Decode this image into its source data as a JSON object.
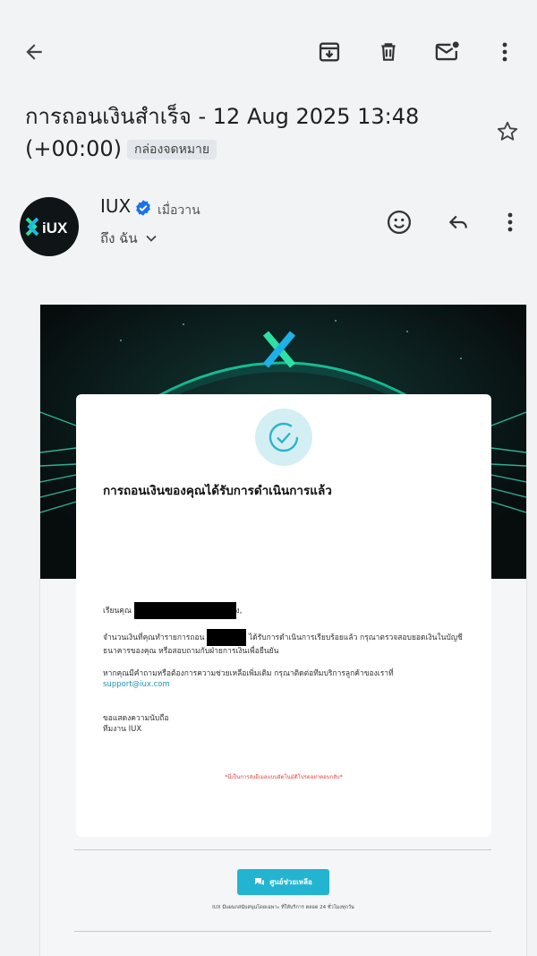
{
  "toolbar": {
    "back": "arrow-back-icon",
    "archive": "archive-icon",
    "delete": "trash-icon",
    "mark_unread": "mark-unread-icon",
    "more": "more-vert-icon"
  },
  "email": {
    "subject": "การถอนเงินสำเร็จ - 12 Aug 2025 13:48 (+00:00)",
    "label": "กล่องจดหมาย",
    "sender": "IUX",
    "time": "เมื่อวาน",
    "to": "ถึง ฉัน",
    "avatar_text": "iUX"
  },
  "body": {
    "title": "การถอนเงินของคุณได้รับการดำเนินการแล้ว",
    "greeting_prefix": "เรียนคุณ",
    "greeting_suffix": "ง,",
    "para1_prefix": "จำนวนเงินที่คุณทำรายการถอน",
    "para1_rest": "ได้รับการดำเนินการเรียบร้อยแล้ว กรุณาตรวจสอบยอดเงินในบัญชีธนาคารของคุณ หรือสอบถามกับฝ่ายการเงินเพื่อยืนยัน",
    "para2": "หากคุณมีคำถามหรือต้องการความช่วยเหลือเพิ่มเติม กรุณาติดต่อทีมบริการลูกค้าของเราที่",
    "support_email": "support@iux.com",
    "thanks": "ขอแสดงความนับถือ",
    "team": "ทีมงาน IUX",
    "auto_note": "*นี่เป็นการส่งอีเมลแบบอัตโนมัติโปรดอย่าตอบกลับ*",
    "help_button": "ศูนย์ช่วยเหลือ",
    "footer": "IUX มีแผนกสนับสนุนโดยเฉพาะ ที่ให้บริการ ตลอด 24 ชั่วโมงทุกวัน"
  },
  "colors": {
    "accent": "#23b4d2",
    "link": "#1d93b3",
    "verified": "#1a73e8",
    "note_red": "#e23b3b"
  }
}
